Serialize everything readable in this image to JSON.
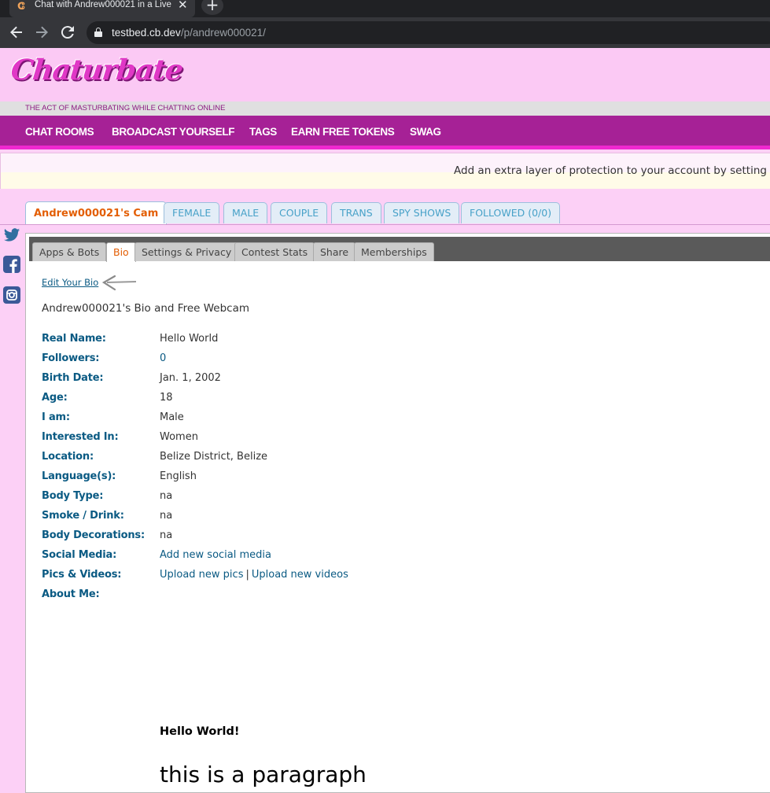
{
  "browser": {
    "tab_title": "Chat with Andrew000021 in a Live",
    "tab_close": "✕",
    "new_tab": "+",
    "url_host": "testbed.cb.dev",
    "url_path": "/p/andrew000021/"
  },
  "site": {
    "logo": "Chaturbate",
    "tagline": "THE ACT OF MASTURBATING WHILE CHATTING ONLINE",
    "brand_color": "#a62196",
    "nav": [
      "CHAT ROOMS",
      "BROADCAST YOURSELF",
      "TAGS",
      "EARN FREE TOKENS",
      "SWAG"
    ]
  },
  "notice": {
    "text": "Add an extra layer of protection to your account by setting up"
  },
  "room_tabs": [
    "Andrew000021's Cam",
    "FEMALE",
    "MALE",
    "COUPLE",
    "TRANS",
    "SPY SHOWS",
    "FOLLOWED (0/0)"
  ],
  "social_icons": [
    "twitter-icon",
    "facebook-icon",
    "instagram-icon"
  ],
  "sub_tabs": [
    "Apps & Bots",
    "Bio",
    "Settings & Privacy",
    "Contest Stats",
    "Share",
    "Memberships"
  ],
  "bio": {
    "edit_link": "Edit Your Bio",
    "heading": "Andrew000021's Bio and Free Webcam",
    "fields": [
      {
        "label": "Real Name:",
        "value": "Hello World"
      },
      {
        "label": "Followers:",
        "value": "0"
      },
      {
        "label": "Birth Date:",
        "value": "Jan. 1, 2002"
      },
      {
        "label": "Age:",
        "value": "18"
      },
      {
        "label": "I am:",
        "value": "Male"
      },
      {
        "label": "Interested In:",
        "value": "Women"
      },
      {
        "label": "Location:",
        "value": "Belize District, Belize"
      },
      {
        "label": "Language(s):",
        "value": "English"
      },
      {
        "label": "Body Type:",
        "value": "na"
      },
      {
        "label": "Smoke / Drink:",
        "value": "na"
      },
      {
        "label": "Body Decorations:",
        "value": "na"
      },
      {
        "label": "Social Media:",
        "value": "Add new social media"
      },
      {
        "label": "Pics & Videos:",
        "value": "Upload new pics",
        "value2": "Upload new videos",
        "separator": "|"
      },
      {
        "label": "About Me:",
        "value": ""
      }
    ],
    "about_heading": "Hello World!",
    "about_paragraph": "this is a paragraph"
  }
}
